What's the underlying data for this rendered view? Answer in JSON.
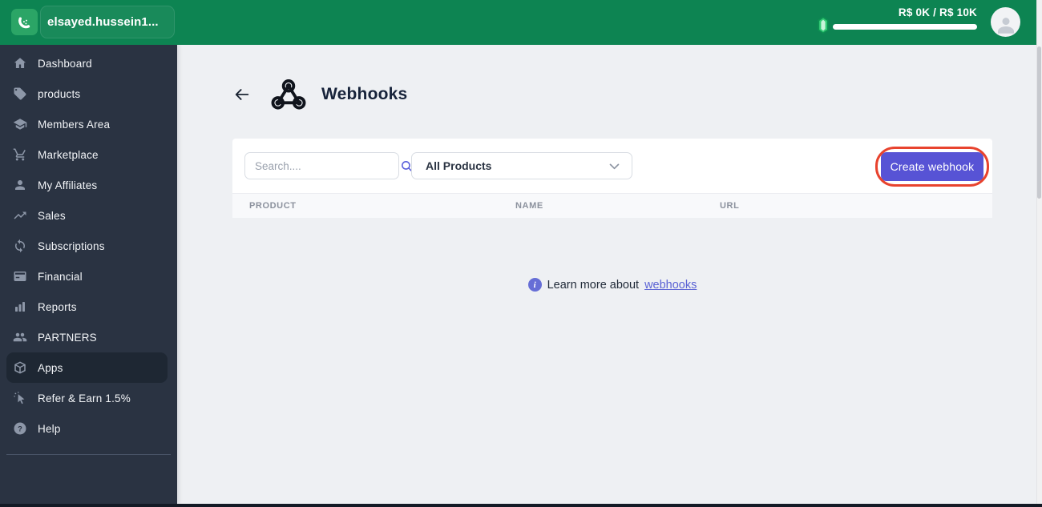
{
  "header": {
    "account_name": "elsayed.hussein1...",
    "usage_text": "R$ 0K / R$ 10K"
  },
  "sidebar": {
    "items": [
      {
        "label": "Dashboard",
        "icon": "home-icon",
        "active": false
      },
      {
        "label": "products",
        "icon": "tag-icon",
        "active": false
      },
      {
        "label": "Members Area",
        "icon": "graduation-cap-icon",
        "active": false
      },
      {
        "label": "Marketplace",
        "icon": "shopping-cart-icon",
        "active": false
      },
      {
        "label": "My Affiliates",
        "icon": "user-icon",
        "active": false
      },
      {
        "label": "Sales",
        "icon": "trending-up-icon",
        "active": false
      },
      {
        "label": "Subscriptions",
        "icon": "sync-icon",
        "active": false
      },
      {
        "label": "Financial",
        "icon": "credit-card-icon",
        "active": false
      },
      {
        "label": "Reports",
        "icon": "bar-chart-icon",
        "active": false
      },
      {
        "label": "PARTNERS",
        "icon": "users-icon",
        "active": false
      },
      {
        "label": "Apps",
        "icon": "cube-icon",
        "active": true
      },
      {
        "label": "Refer & Earn 1.5%",
        "icon": "cursor-click-icon",
        "active": false
      },
      {
        "label": "Help",
        "icon": "help-circle-icon",
        "active": false
      }
    ]
  },
  "main": {
    "title": "Webhooks",
    "toolbar": {
      "search_placeholder": "Search....",
      "product_filter_value": "All Products",
      "create_button_label": "Create webhook"
    },
    "table": {
      "headers": [
        "PRODUCT",
        "NAME",
        "URL"
      ]
    },
    "empty_state": {
      "text": "Learn more about",
      "link_label": "webhooks"
    }
  },
  "colors": {
    "header_green": "#0d8452",
    "logo_green": "#2ba566",
    "sidebar_bg": "#2a3342",
    "sidebar_active_bg": "#1e2733",
    "accent_indigo": "#5753d5",
    "annotation_red": "#e8432e",
    "link_indigo": "#5a62d4"
  }
}
